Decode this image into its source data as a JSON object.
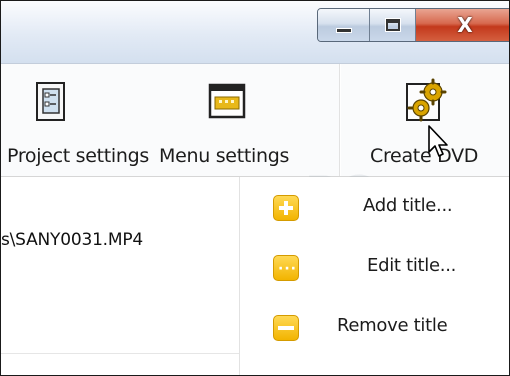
{
  "window": {
    "controls": {
      "minimize_icon": "minimize-icon",
      "maximize_icon": "maximize-icon",
      "close_glyph": "X"
    }
  },
  "toolbar": {
    "items": [
      {
        "label": "Project settings",
        "icon": "project-settings-icon"
      },
      {
        "label": "Menu settings",
        "icon": "menu-settings-icon"
      },
      {
        "label": "Create DVD",
        "icon": "create-dvd-gears-icon"
      }
    ]
  },
  "file_list": {
    "rows": [
      {
        "path": "s\\SANY0031.MP4"
      }
    ]
  },
  "context_menu": {
    "items": [
      {
        "label": "Add title...",
        "icon": "plus-icon"
      },
      {
        "label": "Edit title...",
        "icon": "ellipsis-icon"
      },
      {
        "label": "Remove title",
        "icon": "minus-icon"
      }
    ]
  },
  "watermark": {
    "line1": "PC",
    "line2": "ASTUCES"
  },
  "colors": {
    "menu_icon": "#f6c200",
    "close_button": "#c9452a",
    "titlebar": "#dbe5f1"
  }
}
